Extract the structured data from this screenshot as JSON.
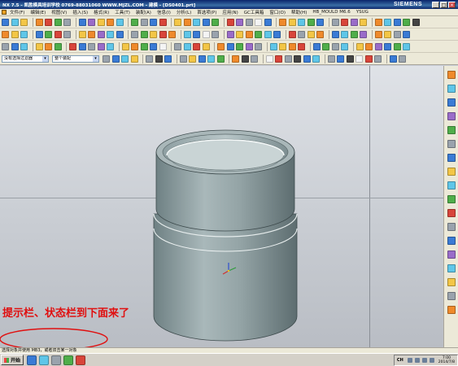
{
  "window": {
    "title": "NX 7.5 - 凯胜模具培训学校 0769-88031060 WWW.MJZL.COM - 建模 - [DS0401.prt]",
    "brand": "SIEMENS",
    "controls": [
      "_",
      "□",
      "×"
    ]
  },
  "menu": [
    "文件(F)",
    "编辑(E)",
    "视图(V)",
    "插入(S)",
    "格式(R)",
    "工具(T)",
    "装配(A)",
    "信息(I)",
    "分析(L)",
    "首选项(P)",
    "应用(N)",
    "GC工具箱",
    "窗口(O)",
    "帮助(H)",
    "HB_MOULD M6.6",
    "YSUG"
  ],
  "toolbar": {
    "filter_select": "没有选择过滤器",
    "scope_select": "整个装配"
  },
  "annotation": {
    "text": "提示栏、状态栏到下面来了",
    "color": "#e01010"
  },
  "status": {
    "prompt": "选择对象并使用 MB3，或者双击某一对象"
  },
  "taskbar": {
    "start_label": "开始",
    "tray_lang": "CH",
    "time": "7:00",
    "date": "2014/7/8"
  }
}
